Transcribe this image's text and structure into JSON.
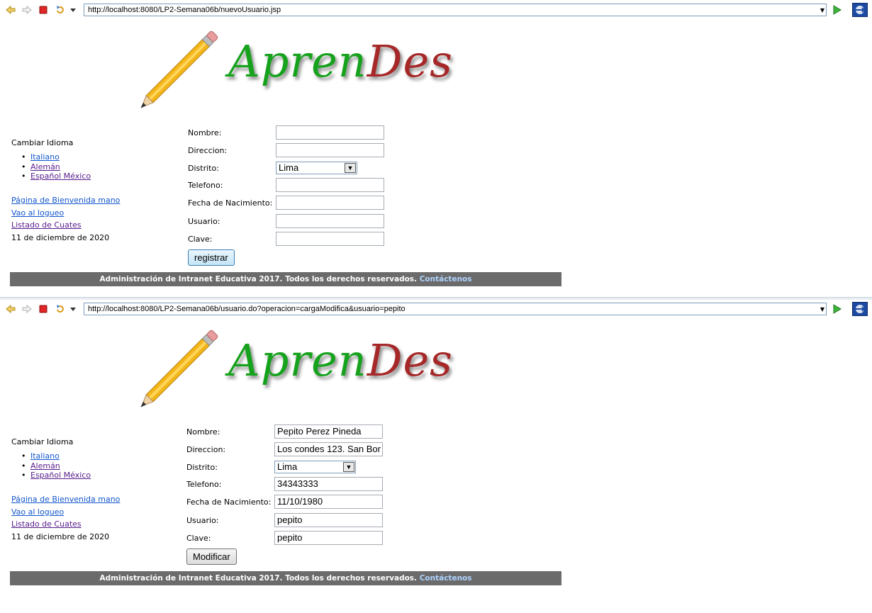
{
  "colors": {
    "logo_green": "#17a21d",
    "logo_red": "#a62828",
    "footer_bg": "#6b6b6b",
    "link": "#1155cc"
  },
  "icons": [
    "back-icon",
    "forward-icon",
    "stop-icon",
    "refresh-icon",
    "menu-dropdown-icon",
    "go-icon",
    "firefox-icon",
    "pencil-icon"
  ],
  "logo": {
    "part1": "Apren",
    "part2": "Des"
  },
  "sidebar": {
    "heading": "Cambiar Idioma",
    "languages": [
      "Italiano",
      "Alemán",
      "Español México"
    ],
    "links": [
      "Página de Bienvenida mano",
      "Vao al logueo",
      "Listado de Cuates"
    ],
    "date": "11 de diciembre de 2020"
  },
  "labels": {
    "nombre": "Nombre:",
    "direccion": "Direccion:",
    "distrito": "Distrito:",
    "telefono": "Telefono:",
    "fecha": "Fecha de Nacimiento:",
    "usuario": "Usuario:",
    "clave": "Clave:"
  },
  "footer": {
    "text": "Administración de Intranet Educativa 2017. Todos los derechos reservados.",
    "contact": "Contáctenos"
  },
  "panels": [
    {
      "url": "http://localhost:8080/LP2-Semana06b/nuevoUsuario.jsp",
      "fields": {
        "nombre": "",
        "direccion": "",
        "distrito": "Lima",
        "telefono": "",
        "fecha": "",
        "usuario": "",
        "clave": ""
      },
      "button": "registrar"
    },
    {
      "url": "http://localhost:8080/LP2-Semana06b/usuario.do?operacion=cargaModifica&usuario=pepito",
      "fields": {
        "nombre": "Pepito Perez Pineda",
        "direccion": "Los condes 123. San Bor",
        "distrito": "Lima",
        "telefono": "34343333",
        "fecha": "11/10/1980",
        "usuario": "pepito",
        "clave": "pepito"
      },
      "button": "Modificar"
    }
  ]
}
